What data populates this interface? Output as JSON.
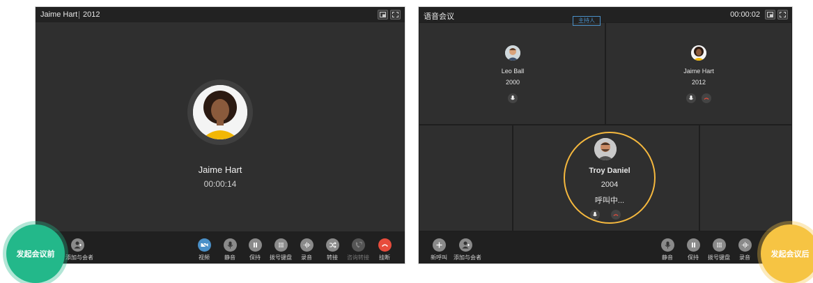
{
  "left_panel": {
    "title_name": "Jaime Hart",
    "title_ext": "2012",
    "caller_name": "Jaime Hart",
    "call_timer": "00:00:14",
    "controls": {
      "add_participant": "添加与会者",
      "video": "视频",
      "mute": "静音",
      "hold": "保持",
      "keypad": "拨号键盘",
      "record": "录音",
      "transfer": "转接",
      "attended_transfer": "咨询转接",
      "hangup": "挂断"
    },
    "badge": "发起会议前"
  },
  "right_panel": {
    "title": "语音会议",
    "timer": "00:00:02",
    "host_tag": "主持人",
    "participants": [
      {
        "name": "Leo Ball",
        "ext": "2000"
      },
      {
        "name": "Jaime Hart",
        "ext": "2012"
      },
      {
        "name": "Troy Daniel",
        "ext": "2004",
        "status": "呼叫中..."
      }
    ],
    "controls": {
      "new_call": "新呼叫",
      "add_participant": "添加与会者",
      "mute": "静音",
      "hold": "保持",
      "keypad": "拨号键盘",
      "record": "录音"
    },
    "badge": "发起会议后"
  },
  "colors": {
    "green_badge": "#23b88a",
    "yellow_badge": "#f6c443",
    "hangup_red": "#e74c3c",
    "accent_blue": "#4a90c8"
  }
}
